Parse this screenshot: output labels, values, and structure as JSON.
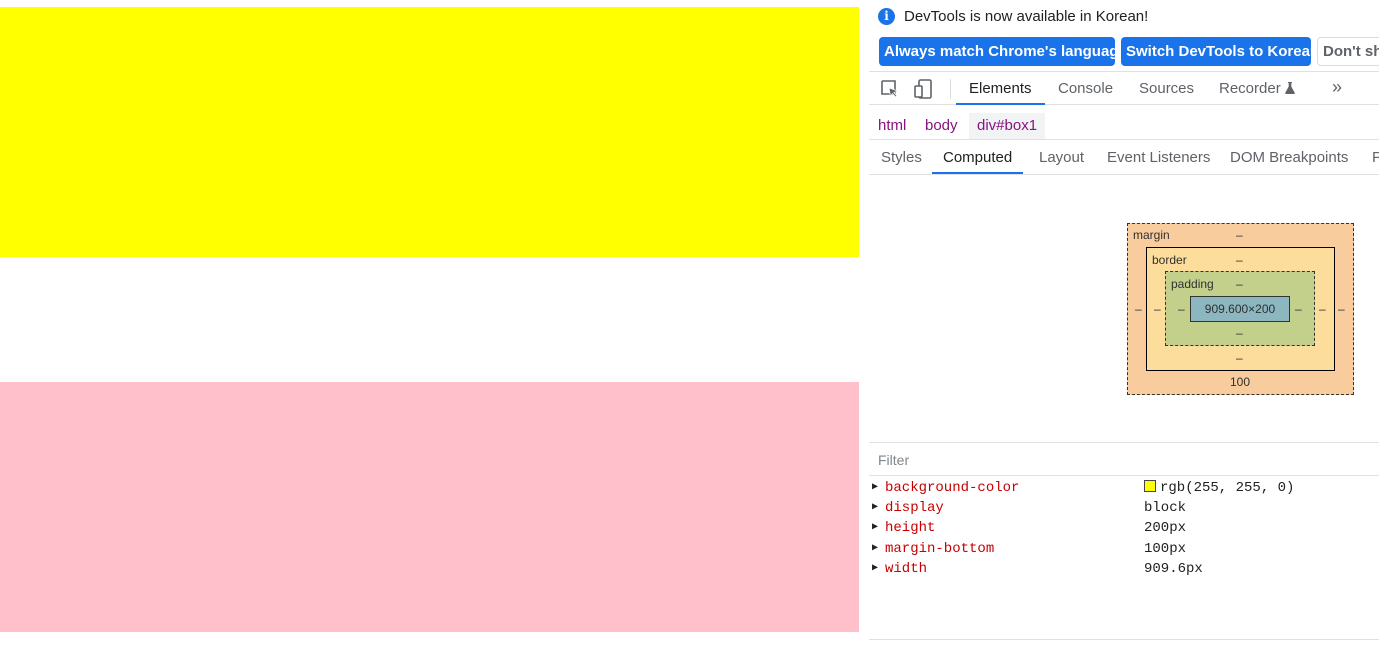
{
  "page": {
    "box1_color": "#ffff00",
    "box2_color": "#ffc0cb"
  },
  "infobar": {
    "message": "DevTools is now available in Korean!",
    "btn_match": "Always match Chrome's language",
    "btn_switch": "Switch DevTools to Korean",
    "btn_dont": "Don't sh"
  },
  "main_tabs": [
    "Elements",
    "Console",
    "Sources",
    "Recorder"
  ],
  "breadcrumb": [
    "html",
    "body",
    "div#box1"
  ],
  "sub_tabs": [
    "Styles",
    "Computed",
    "Layout",
    "Event Listeners",
    "DOM Breakpoints",
    "P"
  ],
  "box_model": {
    "margin_label": "margin",
    "border_label": "border",
    "padding_label": "padding",
    "content": "909.600×200",
    "margin_top": "–",
    "margin_left": "–",
    "margin_right": "–",
    "margin_bottom": "100",
    "border_top": "–",
    "border_left": "–",
    "border_right": "–",
    "border_bottom": "–",
    "padding_top": "–",
    "padding_left": "–",
    "padding_right": "–",
    "padding_bottom": "–"
  },
  "filter": {
    "placeholder": "Filter"
  },
  "computed": [
    {
      "name": "background-color",
      "value": "rgb(255, 255, 0)",
      "swatch": "#ffff00"
    },
    {
      "name": "display",
      "value": "block"
    },
    {
      "name": "height",
      "value": "200px"
    },
    {
      "name": "margin-bottom",
      "value": "100px"
    },
    {
      "name": "width",
      "value": "909.6px"
    }
  ]
}
